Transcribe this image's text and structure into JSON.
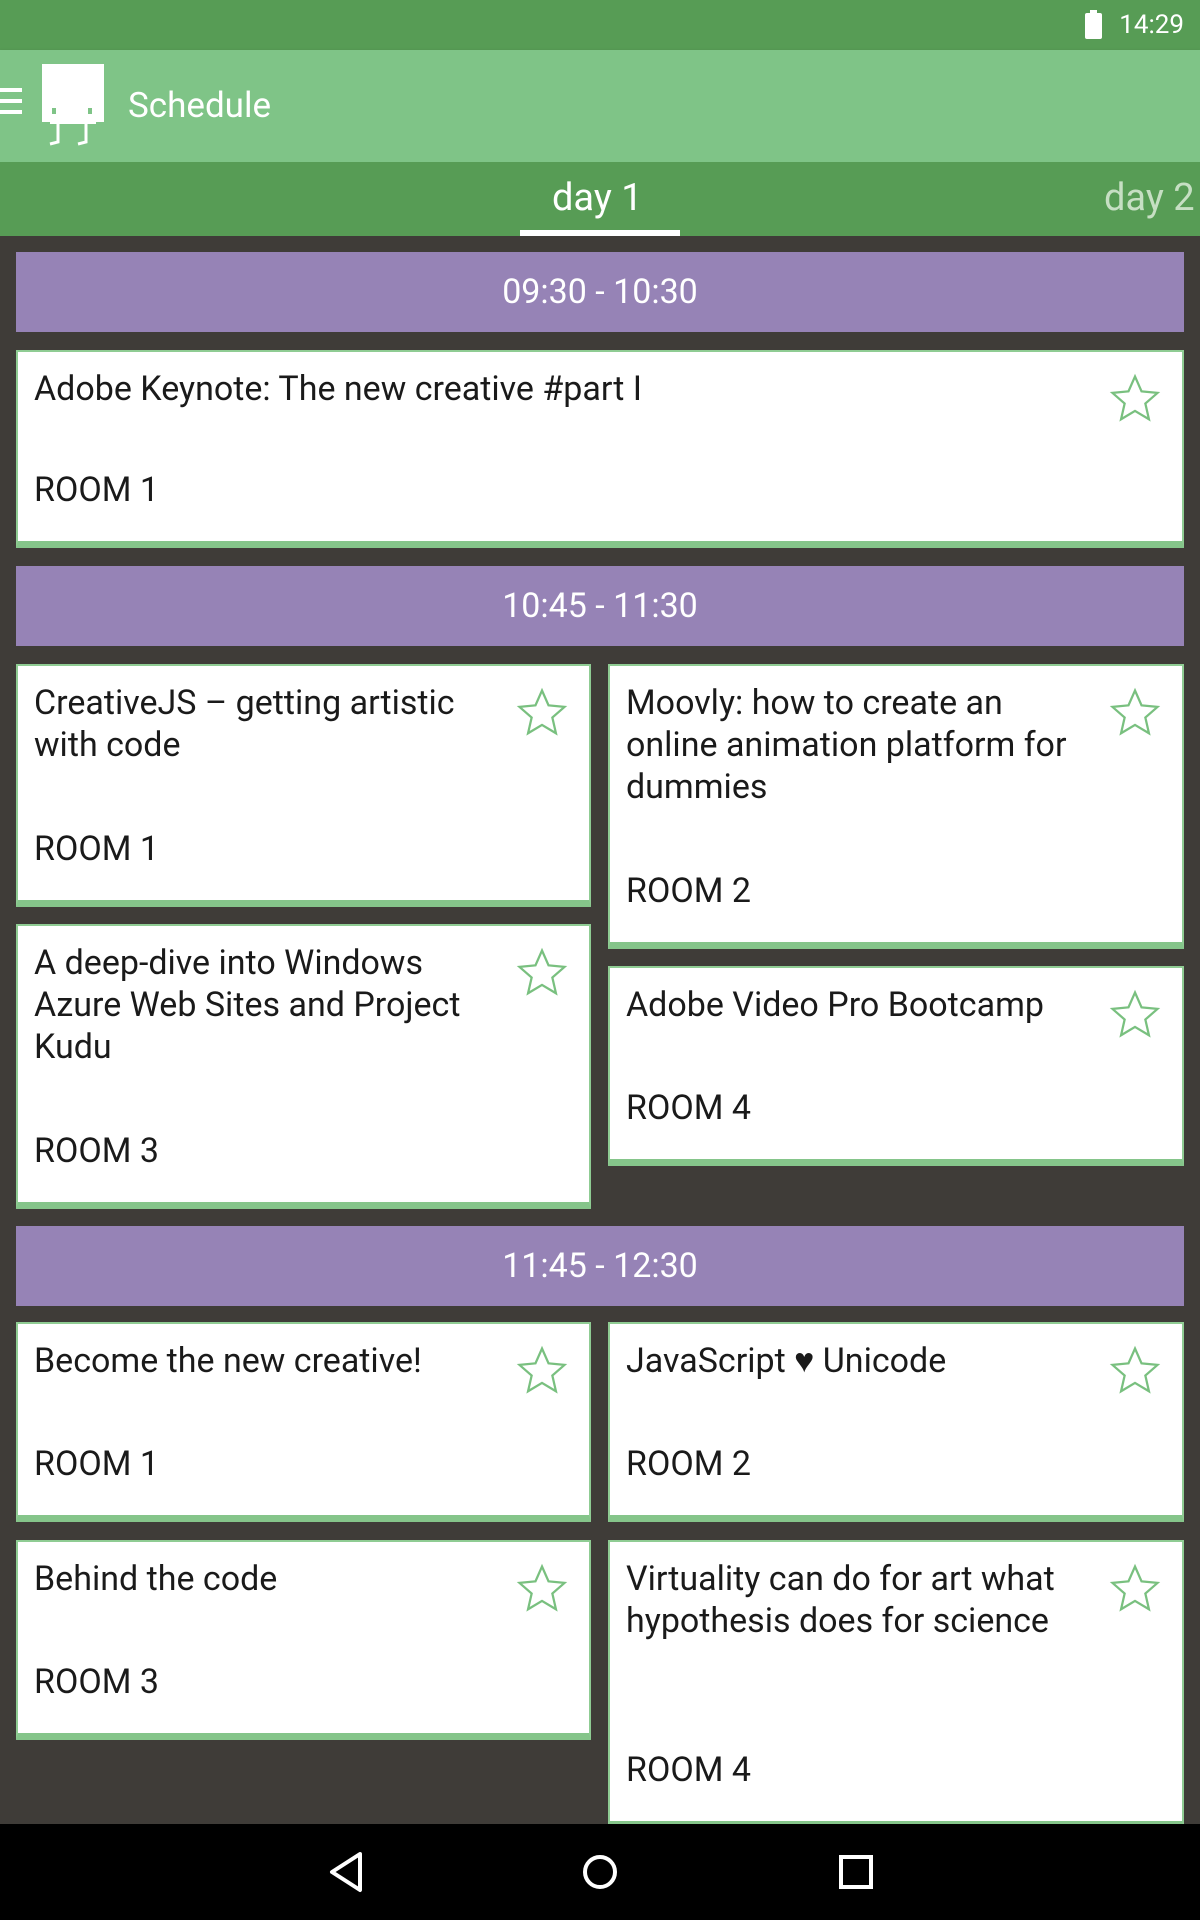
{
  "status_bar": {
    "time": "14:29",
    "battery_icon": "battery-full-icon"
  },
  "app_bar": {
    "title": "Schedule",
    "menu_icon": "hamburger-menu-icon",
    "logo": "app-logo"
  },
  "tabs": [
    {
      "label": "day 1",
      "selected": true
    },
    {
      "label": "day 2",
      "selected": false
    }
  ],
  "slots": [
    {
      "time": "09:30 - 10:30",
      "sessions": [
        {
          "title": "Adobe Keynote: The new creative #part I",
          "room": "ROOM 1",
          "starred": false
        }
      ]
    },
    {
      "time": "10:45 - 11:30",
      "sessions": [
        {
          "title": "CreativeJS – getting artistic with code",
          "room": "ROOM 1",
          "starred": false
        },
        {
          "title": "Moovly: how to create an online animation platform for dummies",
          "room": "ROOM 2",
          "starred": false
        },
        {
          "title": "A deep-dive into Windows Azure Web Sites and Project Kudu",
          "room": "ROOM 3",
          "starred": false
        },
        {
          "title": "Adobe Video Pro Bootcamp",
          "room": "ROOM 4",
          "starred": false
        }
      ]
    },
    {
      "time": "11:45 - 12:30",
      "sessions": [
        {
          "title": "Become the new creative!",
          "room": "ROOM 1",
          "starred": false
        },
        {
          "title": "JavaScript ♥ Unicode",
          "room": "ROOM 2",
          "starred": false
        },
        {
          "title": "Behind the code",
          "room": "ROOM 3",
          "starred": false
        },
        {
          "title": "Virtuality can do for art what hypothesis does for science",
          "room": "ROOM 4",
          "starred": false
        }
      ]
    }
  ],
  "nav_bar": {
    "back": "back-icon",
    "home": "home-icon",
    "recents": "recents-icon"
  },
  "colors": {
    "status_bar": "#579c55",
    "app_bar": "#7fc487",
    "tab_bar": "#579c55",
    "time_header": "#9683b6",
    "background": "#3f3c38",
    "card_accent": "#85c58a"
  }
}
